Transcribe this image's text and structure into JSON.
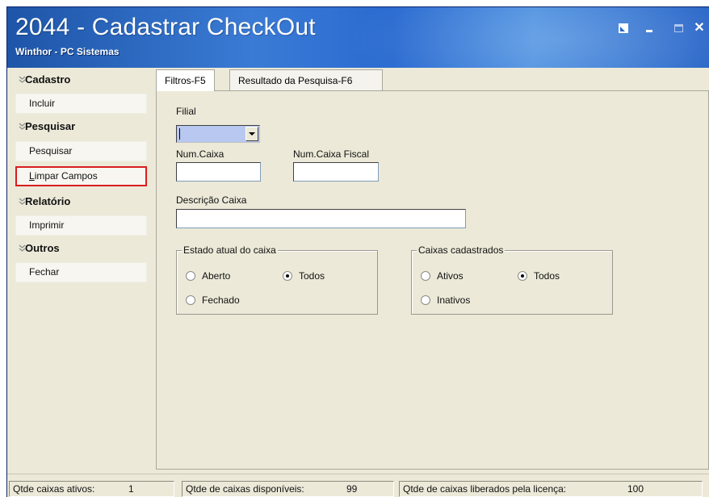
{
  "window": {
    "title": "2044 - Cadastrar CheckOut",
    "subtitle": "Winthor - PC Sistemas",
    "close_glyph": "✕"
  },
  "sidebar": {
    "sections": [
      {
        "header": "Cadastro",
        "items": [
          "Incluir"
        ]
      },
      {
        "header": "Pesquisar",
        "items": [
          "Pesquisar",
          "Limpar Campos"
        ]
      },
      {
        "header": "Relatório",
        "items": [
          "Imprimir"
        ]
      },
      {
        "header": "Outros",
        "items": [
          "Fechar"
        ]
      }
    ],
    "highlighted_item": "Limpar Campos",
    "highlight_color": "#d81e1e"
  },
  "tabs": [
    {
      "label": "Filtros-F5",
      "active": true
    },
    {
      "label": "Resultado da Pesquisa-F6",
      "active": false
    }
  ],
  "filters": {
    "filial_label": "Filial",
    "filial_value": "",
    "num_caixa_label": "Num.Caixa",
    "num_caixa_value": "",
    "num_caixa_fiscal_label": "Num.Caixa Fiscal",
    "num_caixa_fiscal_value": "",
    "descricao_label": "Descrição Caixa",
    "descricao_value": "",
    "estado_group": {
      "title": "Estado atual do caixa",
      "options": [
        "Aberto",
        "Todos",
        "Fechado"
      ],
      "selected": "Todos"
    },
    "cadastrados_group": {
      "title": "Caixas cadastrados",
      "options": [
        "Ativos",
        "Todos",
        "Inativos"
      ],
      "selected": "Todos"
    }
  },
  "status": {
    "ativos_label": "Qtde caixas ativos:",
    "ativos_value": "1",
    "disponiveis_label": "Qtde de caixas disponíveis:",
    "disponiveis_value": "99",
    "liberados_label": "Qtde de caixas liberados pela licença:",
    "liberados_value": "100"
  },
  "colors": {
    "titlebar": "#2a66c8",
    "window_bg": "#ece9d8",
    "combo_bg": "#b8c8f0"
  }
}
